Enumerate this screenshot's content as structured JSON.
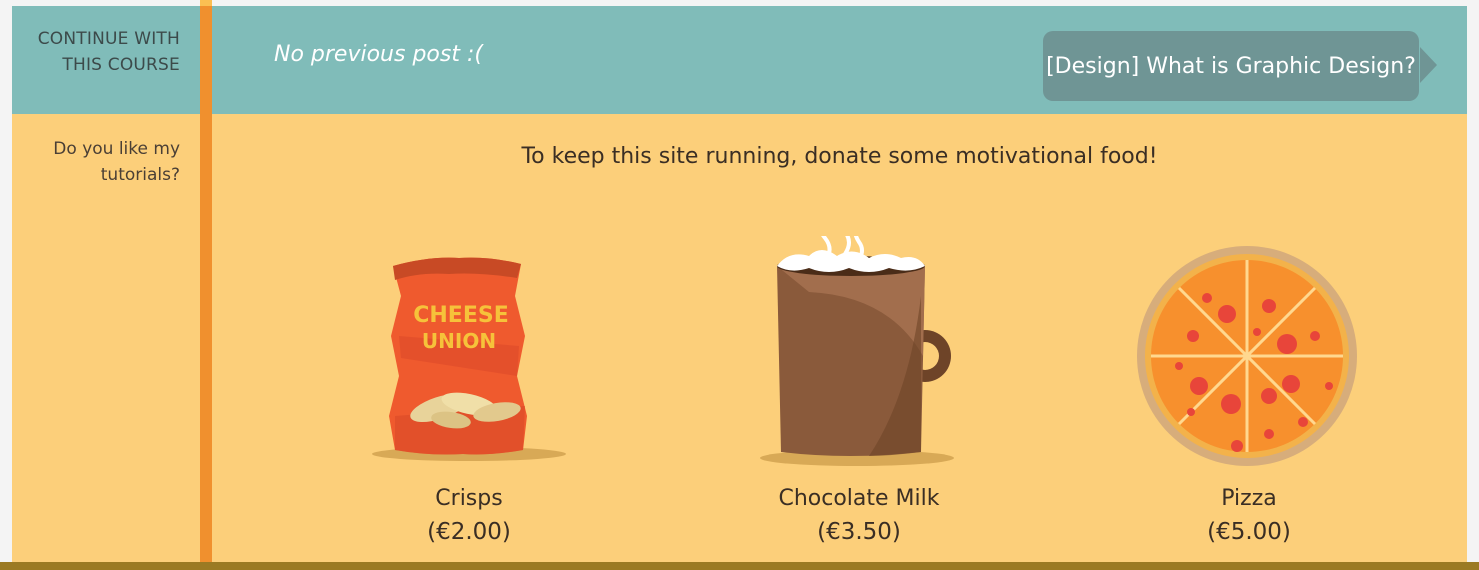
{
  "course_nav": {
    "continue_label": "CONTINUE WITH THIS COURSE",
    "previous_text": "No previous post :(",
    "next_label": "[Design] What is Graphic Design?"
  },
  "donate": {
    "side_label": "Do you like my tutorials?",
    "title": "To keep this site running, donate some motivational food!",
    "items": [
      {
        "name": "Crisps",
        "price": "(€2.00)",
        "icon": "crisps-bag-icon",
        "bag_text": "CHEESE UNION"
      },
      {
        "name": "Chocolate Milk",
        "price": "(€3.50)",
        "icon": "chocolate-milk-mug-icon"
      },
      {
        "name": "Pizza",
        "price": "(€5.00)",
        "icon": "pizza-icon"
      }
    ]
  },
  "colors": {
    "teal": "#80bcb9",
    "orange_stripe": "#f0902e",
    "yellow": "#fccf7a",
    "button": "#6f9595"
  }
}
